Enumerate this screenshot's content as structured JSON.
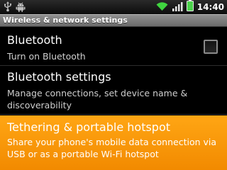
{
  "status_bar": {
    "left_icons": [
      "usb-icon",
      "android-debug-icon"
    ],
    "right_icons": [
      "wifi-icon",
      "signal-icon",
      "battery-icon"
    ],
    "time": "14:40"
  },
  "title_bar": {
    "title": "Wireless & network settings"
  },
  "settings": [
    {
      "title": "Bluetooth",
      "summary": "Turn on Bluetooth",
      "checkbox_checked": false
    },
    {
      "title": "Bluetooth settings",
      "summary": "Manage connections, set device name & discoverability"
    },
    {
      "title": "Tethering & portable hotspot",
      "summary": "Share your phone's mobile data connection via USB or as a portable Wi-Fi hotspot",
      "highlighted": true
    }
  ],
  "colors": {
    "highlight": "#f7931e",
    "background": "#000000",
    "title_bar": "#7d7d7d"
  }
}
